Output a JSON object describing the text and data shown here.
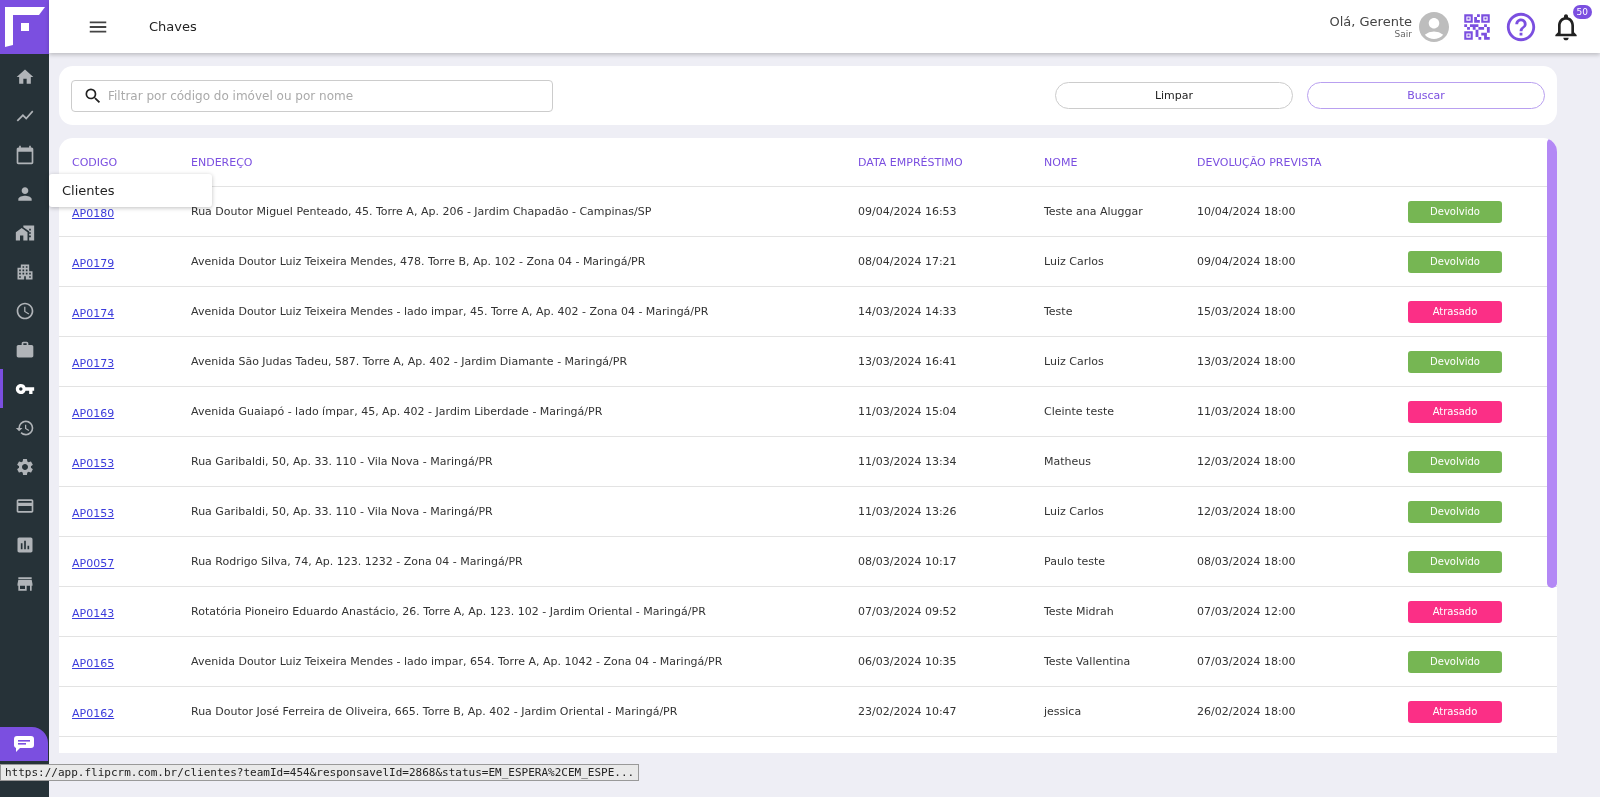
{
  "header": {
    "title": "Chaves",
    "greeting": "Olá, Gerente",
    "logout": "Sair",
    "notifications": "50"
  },
  "sidebar": {
    "items": [
      {
        "selected": false
      },
      {
        "selected": false
      },
      {
        "selected": false
      },
      {
        "selected": false
      },
      {
        "selected": false
      },
      {
        "selected": false
      },
      {
        "selected": false
      },
      {
        "selected": false
      },
      {
        "selected": true
      },
      {
        "selected": false
      },
      {
        "selected": false
      },
      {
        "selected": false
      },
      {
        "selected": false
      },
      {
        "selected": false
      }
    ],
    "tooltip": "Clientes"
  },
  "search": {
    "placeholder": "Filtrar por código do imóvel ou por nome",
    "buttons": [
      "Limpar",
      "Buscar"
    ]
  },
  "table": {
    "columns": [
      "CODIGO",
      "ENDEREÇO",
      "DATA EMPRÉSTIMO",
      "NOME",
      "DEVOLUÇÃO PREVISTA"
    ],
    "rows": [
      {
        "code": "AP0180",
        "address": "Rua Doutor Miguel Penteado, 45. Torre A, Ap. 206 - Jardim Chapadão - Campinas/SP",
        "loan_date": "09/04/2024 16:53",
        "name": "Teste ana Aluggar",
        "due": "10/04/2024 18:00",
        "status": {
          "label": "Devolvido",
          "kind": "returned"
        }
      },
      {
        "code": "AP0179",
        "address": "Avenida Doutor Luiz Teixeira Mendes, 478. Torre B, Ap. 102 - Zona 04 - Maringá/PR",
        "loan_date": "08/04/2024 17:21",
        "name": "Luiz Carlos",
        "due": "09/04/2024 18:00",
        "status": {
          "label": "Devolvido",
          "kind": "returned"
        }
      },
      {
        "code": "AP0174",
        "address": "Avenida Doutor Luiz Teixeira Mendes - lado impar, 45. Torre A, Ap. 402 - Zona 04 - Maringá/PR",
        "loan_date": "14/03/2024 14:33",
        "name": "Teste",
        "due": "15/03/2024 18:00",
        "status": {
          "label": "Atrasado",
          "kind": "late"
        }
      },
      {
        "code": "AP0173",
        "address": "Avenida São Judas Tadeu, 587. Torre A, Ap. 402 - Jardim Diamante - Maringá/PR",
        "loan_date": "13/03/2024 16:41",
        "name": "Luiz Carlos",
        "due": "13/03/2024 18:00",
        "status": {
          "label": "Devolvido",
          "kind": "returned"
        }
      },
      {
        "code": "AP0169",
        "address": "Avenida Guaiapó - lado ímpar, 45, Ap. 402 - Jardim Liberdade - Maringá/PR",
        "loan_date": "11/03/2024 15:04",
        "name": "Cleinte teste",
        "due": "11/03/2024 18:00",
        "status": {
          "label": "Atrasado",
          "kind": "late"
        }
      },
      {
        "code": "AP0153",
        "address": "Rua Garibaldi, 50, Ap. 33. 110 - Vila Nova - Maringá/PR",
        "loan_date": "11/03/2024 13:34",
        "name": "Matheus",
        "due": "12/03/2024 18:00",
        "status": {
          "label": "Devolvido",
          "kind": "returned"
        }
      },
      {
        "code": "AP0153",
        "address": "Rua Garibaldi, 50, Ap. 33. 110 - Vila Nova - Maringá/PR",
        "loan_date": "11/03/2024 13:26",
        "name": "Luiz Carlos",
        "due": "12/03/2024 18:00",
        "status": {
          "label": "Devolvido",
          "kind": "returned"
        }
      },
      {
        "code": "AP0057",
        "address": "Rua Rodrigo Silva, 74, Ap. 123. 1232 - Zona 04 - Maringá/PR",
        "loan_date": "08/03/2024 10:17",
        "name": "Paulo teste",
        "due": "08/03/2024 18:00",
        "status": {
          "label": "Devolvido",
          "kind": "returned"
        }
      },
      {
        "code": "AP0143",
        "address": "Rotatória Pioneiro Eduardo Anastácio, 26. Torre A, Ap. 123. 102 - Jardim Oriental - Maringá/PR",
        "loan_date": "07/03/2024 09:52",
        "name": "Teste Midrah",
        "due": "07/03/2024 12:00",
        "status": {
          "label": "Atrasado",
          "kind": "late"
        }
      },
      {
        "code": "AP0165",
        "address": "Avenida Doutor Luiz Teixeira Mendes - lado impar, 654. Torre A, Ap. 1042 - Zona 04 - Maringá/PR",
        "loan_date": "06/03/2024 10:35",
        "name": "Teste Vallentina",
        "due": "07/03/2024 18:00",
        "status": {
          "label": "Devolvido",
          "kind": "returned"
        }
      },
      {
        "code": "AP0162",
        "address": "Rua Doutor José Ferreira de Oliveira, 665. Torre B, Ap. 402 - Jardim Oriental - Maringá/PR",
        "loan_date": "23/02/2024 10:47",
        "name": "jessica",
        "due": "26/02/2024 18:00",
        "status": {
          "label": "Atrasado",
          "kind": "late"
        }
      }
    ]
  },
  "status_bar": "https://app.flipcrm.com.br/clientes?teamId=454&responsavelId=2868&status=EM_ESPERA%2CEM_ESPE..."
}
